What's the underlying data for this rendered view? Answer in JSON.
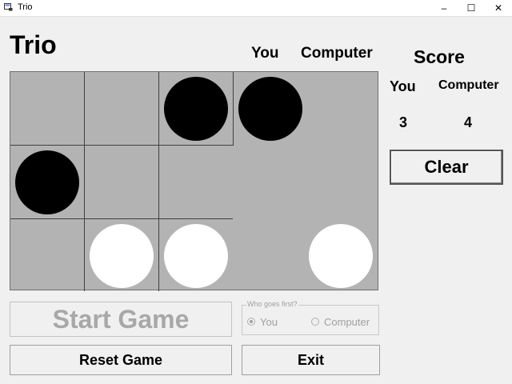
{
  "window": {
    "title": "Trio",
    "minimize_glyph": "–",
    "maximize_glyph": "☐",
    "close_glyph": "✕"
  },
  "game": {
    "title": "Trio",
    "column_you": "You",
    "column_computer": "Computer",
    "board": {
      "rows": 3,
      "cols": 5,
      "pieces": [
        {
          "row": 0,
          "col": 2,
          "color": "black"
        },
        {
          "row": 0,
          "col": 3,
          "color": "black"
        },
        {
          "row": 1,
          "col": 0,
          "color": "black"
        },
        {
          "row": 2,
          "col": 1,
          "color": "white"
        },
        {
          "row": 2,
          "col": 2,
          "color": "white"
        },
        {
          "row": 2,
          "col": 4,
          "color": "white"
        }
      ]
    }
  },
  "score": {
    "title": "Score",
    "you_label": "You",
    "computer_label": "Computer",
    "you_value": "3",
    "computer_value": "4"
  },
  "buttons": {
    "clear": "Clear",
    "start": "Start Game",
    "reset": "Reset Game",
    "exit": "Exit"
  },
  "who_first": {
    "legend": "Who goes first?",
    "options": [
      "You",
      "Computer"
    ],
    "selected": "You"
  },
  "colors": {
    "board": "#b3b3b3",
    "grid": "#404040",
    "disabled_text": "#a8a8a8"
  }
}
